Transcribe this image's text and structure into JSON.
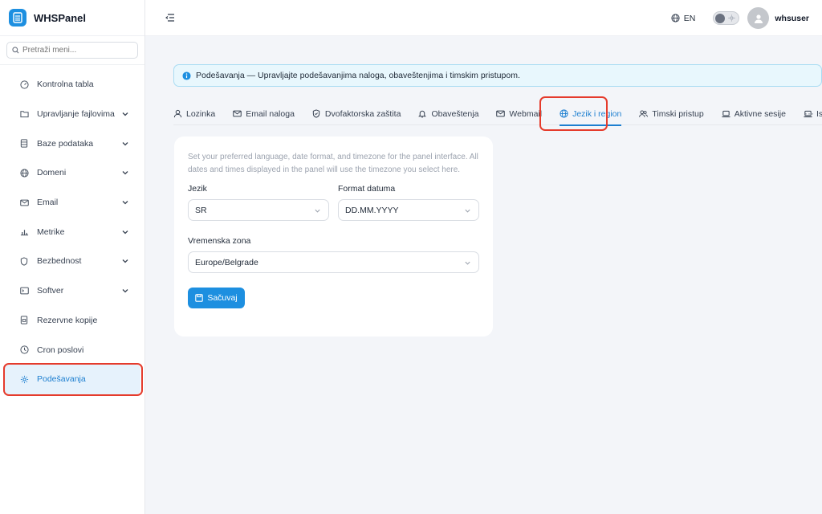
{
  "brand": {
    "name": "WHSPanel"
  },
  "sidebar": {
    "search_placeholder": "Pretraži meni...",
    "items": [
      {
        "label": "Kontrolna tabla",
        "icon": "dashboard-icon",
        "has_children": false
      },
      {
        "label": "Upravljanje fajlovima",
        "icon": "folder-icon",
        "has_children": true
      },
      {
        "label": "Baze podataka",
        "icon": "database-icon",
        "has_children": true
      },
      {
        "label": "Domeni",
        "icon": "globe-icon",
        "has_children": true
      },
      {
        "label": "Email",
        "icon": "mail-icon",
        "has_children": true
      },
      {
        "label": "Metrike",
        "icon": "chart-icon",
        "has_children": true
      },
      {
        "label": "Bezbednost",
        "icon": "shield-icon",
        "has_children": true
      },
      {
        "label": "Softver",
        "icon": "terminal-icon",
        "has_children": true
      },
      {
        "label": "Rezervne kopije",
        "icon": "archive-icon",
        "has_children": false
      },
      {
        "label": "Cron poslovi",
        "icon": "clock-icon",
        "has_children": false
      },
      {
        "label": "Podešavanja",
        "icon": "gear-icon",
        "has_children": false,
        "active": true
      }
    ]
  },
  "topbar": {
    "language": "EN",
    "username": "whsuser"
  },
  "banner": {
    "text": "Podešavanja — Upravljajte podešavanjima naloga, obaveštenjima i timskim pristupom."
  },
  "tabs": [
    {
      "label": "Lozinka",
      "icon": "user-icon"
    },
    {
      "label": "Email naloga",
      "icon": "mail-icon"
    },
    {
      "label": "Dvofaktorska zaštita",
      "icon": "shield-icon"
    },
    {
      "label": "Obaveštenja",
      "icon": "bell-icon"
    },
    {
      "label": "Webmail",
      "icon": "mail-icon"
    },
    {
      "label": "Jezik i region",
      "icon": "globe-icon",
      "active": true
    },
    {
      "label": "Timski pristup",
      "icon": "users-icon"
    },
    {
      "label": "Aktivne sesije",
      "icon": "laptop-icon"
    },
    {
      "label": "Is",
      "icon": "laptop-icon"
    }
  ],
  "form": {
    "description": "Set your preferred language, date format, and timezone for the panel interface. All dates and times displayed in the panel will use the timezone you select here.",
    "language_label": "Jezik",
    "language_value": "SR",
    "date_format_label": "Format datuma",
    "date_format_value": "DD.MM.YYYY",
    "timezone_label": "Vremenska zona",
    "timezone_value": "Europe/Belgrade",
    "save_label": "Sačuvaj"
  },
  "colors": {
    "accent": "#1d8fe0",
    "highlight": "#e53b2c",
    "banner_bg": "#e8f7fd"
  }
}
